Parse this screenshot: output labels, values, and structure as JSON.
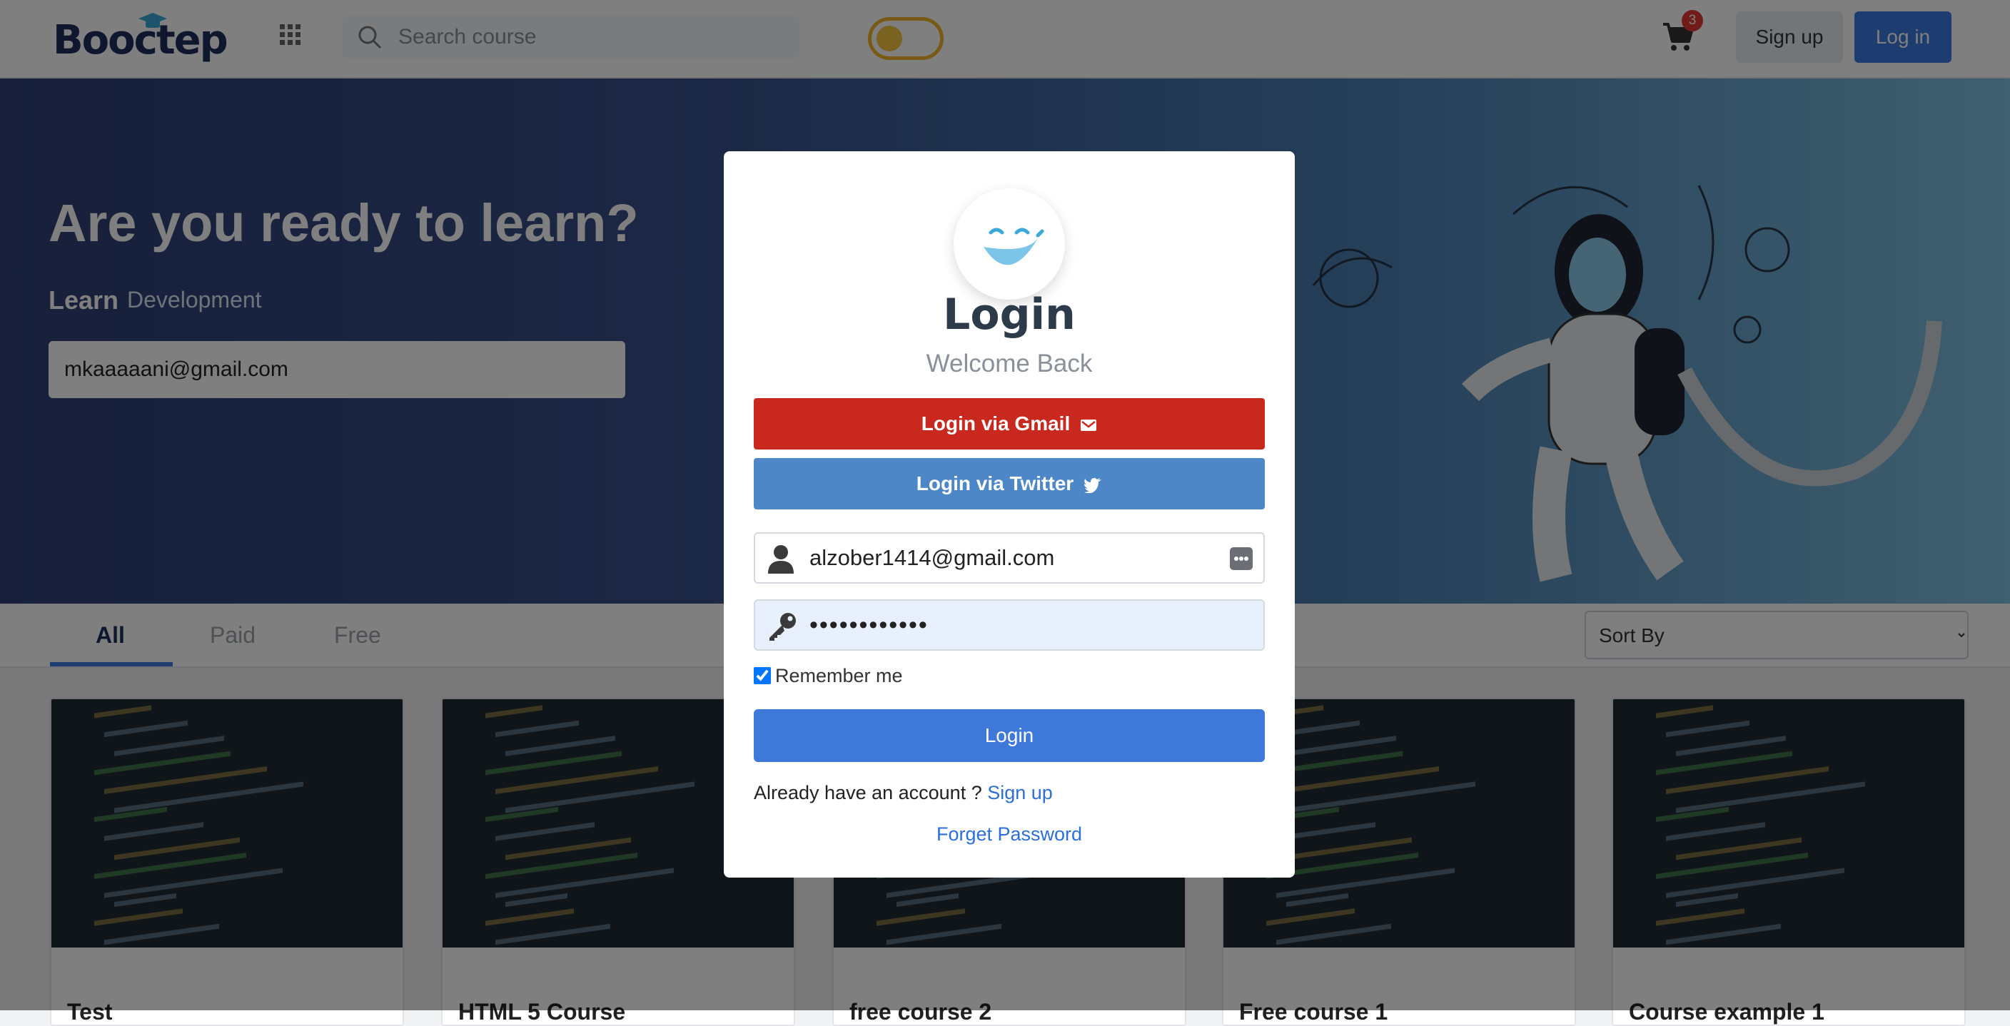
{
  "header": {
    "logo_text": "Booctep",
    "search_placeholder": "Search course",
    "cart_count": "3",
    "signup_label": "Sign up",
    "login_label": "Log in"
  },
  "hero": {
    "title": "Are you ready to learn?",
    "learn_label": "Learn",
    "typed_word": "Development",
    "email_value": "mkaaaaani@gmail.com"
  },
  "tabs": [
    {
      "label": "All",
      "active": true
    },
    {
      "label": "Paid",
      "active": false
    },
    {
      "label": "Free",
      "active": false
    }
  ],
  "sort": {
    "selected": "Sort By"
  },
  "courses": [
    {
      "title": "Test"
    },
    {
      "title": "HTML 5 Course"
    },
    {
      "title": "free course 2"
    },
    {
      "title": "Free course 1"
    },
    {
      "title": "Course example 1"
    }
  ],
  "modal": {
    "title": "Login",
    "subtitle": "Welcome Back",
    "gmail_label": "Login via Gmail",
    "twitter_label": "Login via Twitter",
    "email_value": "alzober1414@gmail.com",
    "password_value": "••••••••••••",
    "remember_label": "Remember me",
    "remember_checked": true,
    "login_label": "Login",
    "already_text": "Already have an account ?",
    "signup_link": "Sign up",
    "forget_label": "Forget Password"
  },
  "colors": {
    "primary": "#3e78d8",
    "gmail": "#c9281f",
    "twitter": "#4e87c7",
    "brand_dark": "#1d2f5c",
    "badge": "#e53935"
  }
}
